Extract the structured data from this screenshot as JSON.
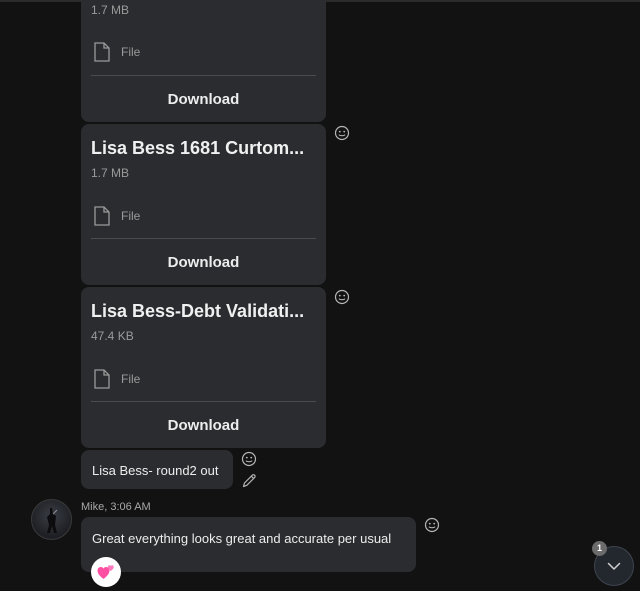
{
  "files": [
    {
      "title": "",
      "size": "1.7 MB",
      "type_label": "File",
      "download_label": "Download"
    },
    {
      "title": "Lisa Bess 1681 Curtom...",
      "size": "1.7 MB",
      "type_label": "File",
      "download_label": "Download"
    },
    {
      "title": "Lisa Bess-Debt Validati...",
      "size": "47.4 KB",
      "type_label": "File",
      "download_label": "Download"
    }
  ],
  "messages": [
    {
      "text": "Lisa Bess- round2 out"
    },
    {
      "sender": "Mike",
      "time": "3:06 AM",
      "sender_line": "Mike, 3:06 AM",
      "text": "Great everything looks great and accurate per usual",
      "reaction": "two-hearts"
    }
  ],
  "scroll_to_bottom": {
    "badge_count": "1"
  },
  "icons": {
    "react": "smiley-icon",
    "edit": "pencil-icon",
    "file": "file-icon",
    "scroll": "chevron-down-icon"
  }
}
